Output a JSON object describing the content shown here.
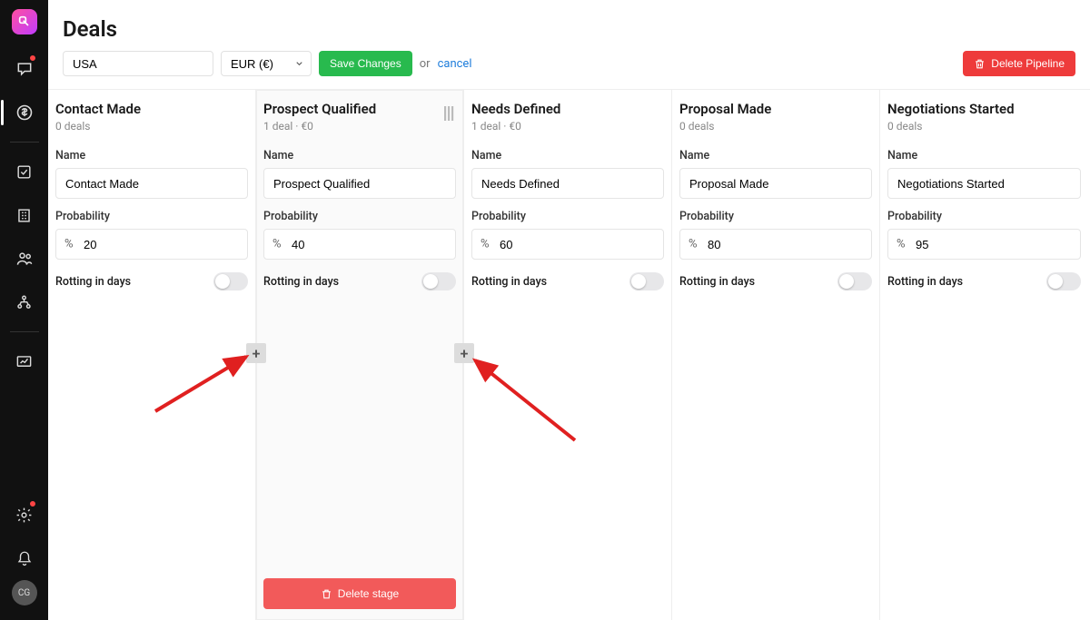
{
  "page": {
    "title": "Deals"
  },
  "toolbar": {
    "pipeline_name": "USA",
    "currency": "EUR (€)",
    "save_label": "Save Changes",
    "or_label": "or",
    "cancel_label": "cancel",
    "delete_pipeline_label": "Delete Pipeline"
  },
  "labels": {
    "name": "Name",
    "probability": "Probability",
    "rotting": "Rotting in days",
    "percent": "%",
    "delete_stage": "Delete stage"
  },
  "stages": [
    {
      "title": "Contact Made",
      "subtitle": "0 deals",
      "name_value": "Contact Made",
      "probability": "20"
    },
    {
      "title": "Prospect Qualified",
      "subtitle": "1 deal · €0",
      "name_value": "Prospect Qualified",
      "probability": "40",
      "active": true,
      "show_handle": true,
      "show_delete": true
    },
    {
      "title": "Needs Defined",
      "subtitle": "1 deal · €0",
      "name_value": "Needs Defined",
      "probability": "60"
    },
    {
      "title": "Proposal Made",
      "subtitle": "0 deals",
      "name_value": "Proposal Made",
      "probability": "80"
    },
    {
      "title": "Negotiations Started",
      "subtitle": "0 deals",
      "name_value": "Negotiations Started",
      "probability": "95"
    }
  ],
  "avatar": {
    "initials": "CG"
  },
  "colors": {
    "accent_green": "#28ba4e",
    "accent_red": "#ee3b3b",
    "link": "#1e7ddb"
  }
}
